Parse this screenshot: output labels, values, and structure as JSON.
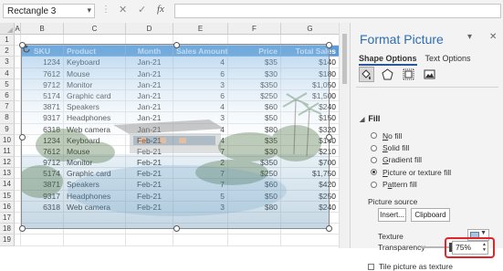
{
  "formula_bar": {
    "name_box": "Rectangle 3",
    "cancel_glyph": "✕",
    "enter_glyph": "✓",
    "fx_glyph": "fx",
    "formula": ""
  },
  "sheet": {
    "columns": [
      "A",
      "B",
      "C",
      "D",
      "E",
      "F",
      "G"
    ],
    "rows": [
      "1",
      "2",
      "3",
      "4",
      "5",
      "6",
      "7",
      "8",
      "9",
      "10",
      "11",
      "12",
      "13",
      "14",
      "15",
      "16",
      "17",
      "18",
      "19"
    ],
    "table_headers": [
      "SKU",
      "Product",
      "Month",
      "Sales Amount",
      "Price",
      "Total Sales"
    ],
    "table_rows": [
      [
        "1234",
        "Keyboard",
        "Jan-21",
        "4",
        "$35",
        "$140"
      ],
      [
        "7612",
        "Mouse",
        "Jan-21",
        "6",
        "$30",
        "$180"
      ],
      [
        "9712",
        "Monitor",
        "Jan-21",
        "3",
        "$350",
        "$1,050"
      ],
      [
        "5174",
        "Graphic card",
        "Jan-21",
        "6",
        "$250",
        "$1,500"
      ],
      [
        "3871",
        "Speakers",
        "Jan-21",
        "4",
        "$60",
        "$240"
      ],
      [
        "9317",
        "Headphones",
        "Jan-21",
        "3",
        "$50",
        "$150"
      ],
      [
        "6318",
        "Web camera",
        "Jan-21",
        "4",
        "$80",
        "$320"
      ],
      [
        "1234",
        "Keyboard",
        "Feb-21",
        "4",
        "$35",
        "$140"
      ],
      [
        "7612",
        "Mouse",
        "Feb-21",
        "7",
        "$30",
        "$210"
      ],
      [
        "9712",
        "Monitor",
        "Feb-21",
        "2",
        "$350",
        "$700"
      ],
      [
        "5174",
        "Graphic card",
        "Feb-21",
        "7",
        "$250",
        "$1,750"
      ],
      [
        "3871",
        "Speakers",
        "Feb-21",
        "7",
        "$60",
        "$420"
      ],
      [
        "9317",
        "Headphones",
        "Feb-21",
        "5",
        "$50",
        "$250"
      ],
      [
        "6318",
        "Web camera",
        "Feb-21",
        "3",
        "$80",
        "$240"
      ]
    ],
    "header_color": "#5b9bd5"
  },
  "pane": {
    "title": "Format Picture",
    "dropdown_glyph": "▾",
    "close_glyph": "✕",
    "tabs": [
      "Shape Options",
      "Text Options"
    ],
    "section": "Fill",
    "section_glyph": "◢",
    "fill_options": [
      {
        "pre": "",
        "key": "N",
        "post": "o fill"
      },
      {
        "pre": "",
        "key": "S",
        "post": "olid fill"
      },
      {
        "pre": "",
        "key": "G",
        "post": "radient fill"
      },
      {
        "pre": "",
        "key": "P",
        "post": "icture or texture fill"
      },
      {
        "pre": "P",
        "key": "a",
        "post": "ttern fill"
      }
    ],
    "selected_fill_index": 3,
    "picture_source_label": "Picture source",
    "insert_button": "Insert...",
    "clipboard_button": "Clipboard",
    "texture_label": "Texture",
    "transparency_label": "Transparency",
    "transparency_value": "75%",
    "transparency_fraction": 0.75,
    "tile_label": "Tile picture as texture",
    "accent_color": "#2f6db3",
    "highlight_color": "#e0242c"
  }
}
